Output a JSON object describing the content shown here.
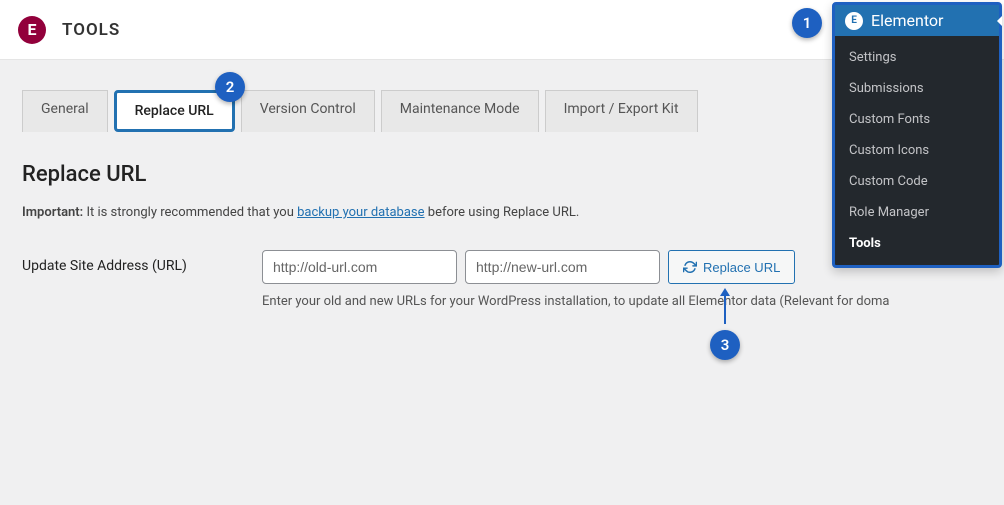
{
  "header": {
    "logo_letter": "E",
    "title": "TOOLS"
  },
  "tabs": [
    {
      "label": "General",
      "class": ""
    },
    {
      "label": "Replace URL",
      "class": "highlighted"
    },
    {
      "label": "Version Control",
      "class": ""
    },
    {
      "label": "Maintenance Mode",
      "class": ""
    },
    {
      "label": "Import / Export Kit",
      "class": ""
    }
  ],
  "page": {
    "heading": "Replace URL",
    "notice_strong": "Important:",
    "notice_before": " It is strongly recommended that you ",
    "notice_link": "backup your database",
    "notice_after": " before using Replace URL."
  },
  "form": {
    "label": "Update Site Address (URL)",
    "old_placeholder": "http://old-url.com",
    "new_placeholder": "http://new-url.com",
    "button_label": "Replace URL",
    "helper": "Enter your old and new URLs for your WordPress installation, to update all Elementor data (Relevant for doma"
  },
  "side_menu": {
    "title": "Elementor",
    "items": [
      {
        "label": "Settings",
        "active": false
      },
      {
        "label": "Submissions",
        "active": false
      },
      {
        "label": "Custom Fonts",
        "active": false
      },
      {
        "label": "Custom Icons",
        "active": false
      },
      {
        "label": "Custom Code",
        "active": false
      },
      {
        "label": "Role Manager",
        "active": false
      },
      {
        "label": "Tools",
        "active": true
      }
    ]
  },
  "badges": {
    "b1": "1",
    "b2": "2",
    "b3": "3"
  }
}
